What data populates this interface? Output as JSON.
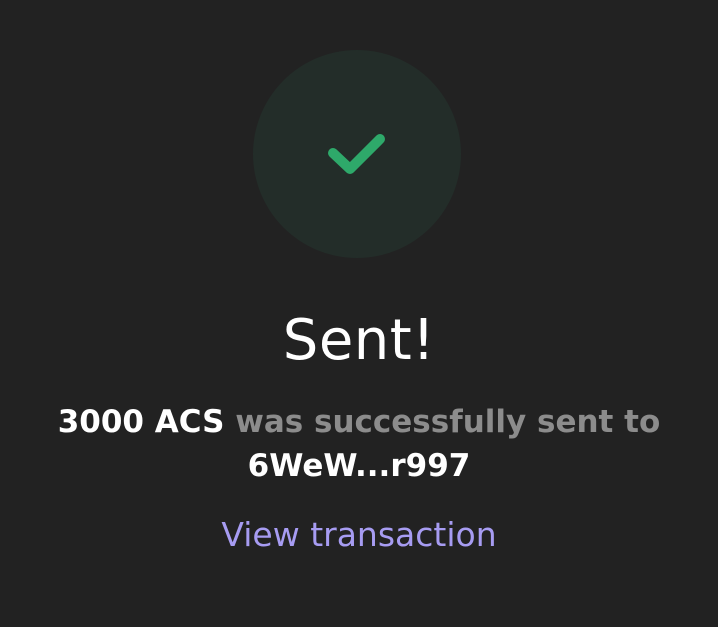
{
  "status": {
    "icon": "check-icon",
    "icon_color": "#2ea96a",
    "circle_color": "#232d29",
    "title": "Sent!"
  },
  "message": {
    "amount": "3000 ACS",
    "text": "was successfully sent to",
    "address": "6WeW...r997"
  },
  "actions": {
    "view_transaction_label": "View transaction",
    "link_color": "#a79cf2"
  }
}
